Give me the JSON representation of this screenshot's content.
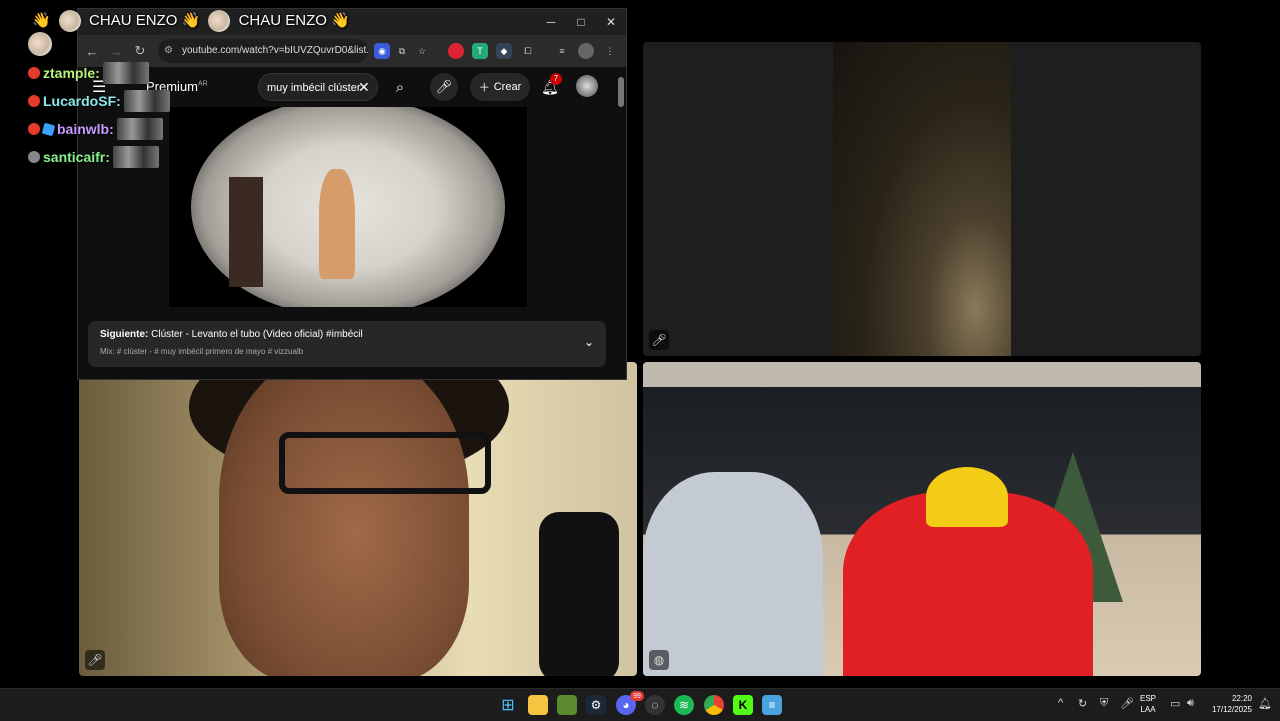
{
  "browser": {
    "url": "youtube.com/watch?v=bIUVZQuvrD0&list...",
    "window_buttons": {
      "minimize": "─",
      "maximize": "□",
      "close": "✕"
    },
    "nav": {
      "back": "←",
      "forward": "→",
      "reload": "↻"
    }
  },
  "youtube": {
    "logo": "Premium",
    "logo_country": "AR",
    "search_value": "muy imbécil clúster",
    "clear_icon": "✕",
    "create_label": "Crear",
    "notification_count": "7",
    "up_next": {
      "prefix": "Siguiente:",
      "title": "Clúster - Levanto el tubo (Video oficial) #imbécil",
      "mix": "Mix: # clúster - # muy imbécil primero de mayo # vizzualb"
    }
  },
  "announcement": {
    "text1": "CHAU ENZO",
    "text2": "CHAU ENZO",
    "wave": "👋"
  },
  "chat": [
    {
      "user": "ztample:",
      "color": "#b8f27a",
      "badge": "dot"
    },
    {
      "user": "LucardoSF:",
      "color": "#8fe6e6",
      "badge": "dot"
    },
    {
      "user": "bainwlb:",
      "color": "#c49cff",
      "badge": "dot-cube"
    },
    {
      "user": "santicaifr:",
      "color": "#8cf08c",
      "badge": "dot-grey"
    }
  ],
  "taskbar": {
    "chevron": "^",
    "lang_line1": "ESP",
    "lang_line2": "LAA",
    "time": "22:20",
    "date": "17/12/2025",
    "discord_badge": "99"
  }
}
